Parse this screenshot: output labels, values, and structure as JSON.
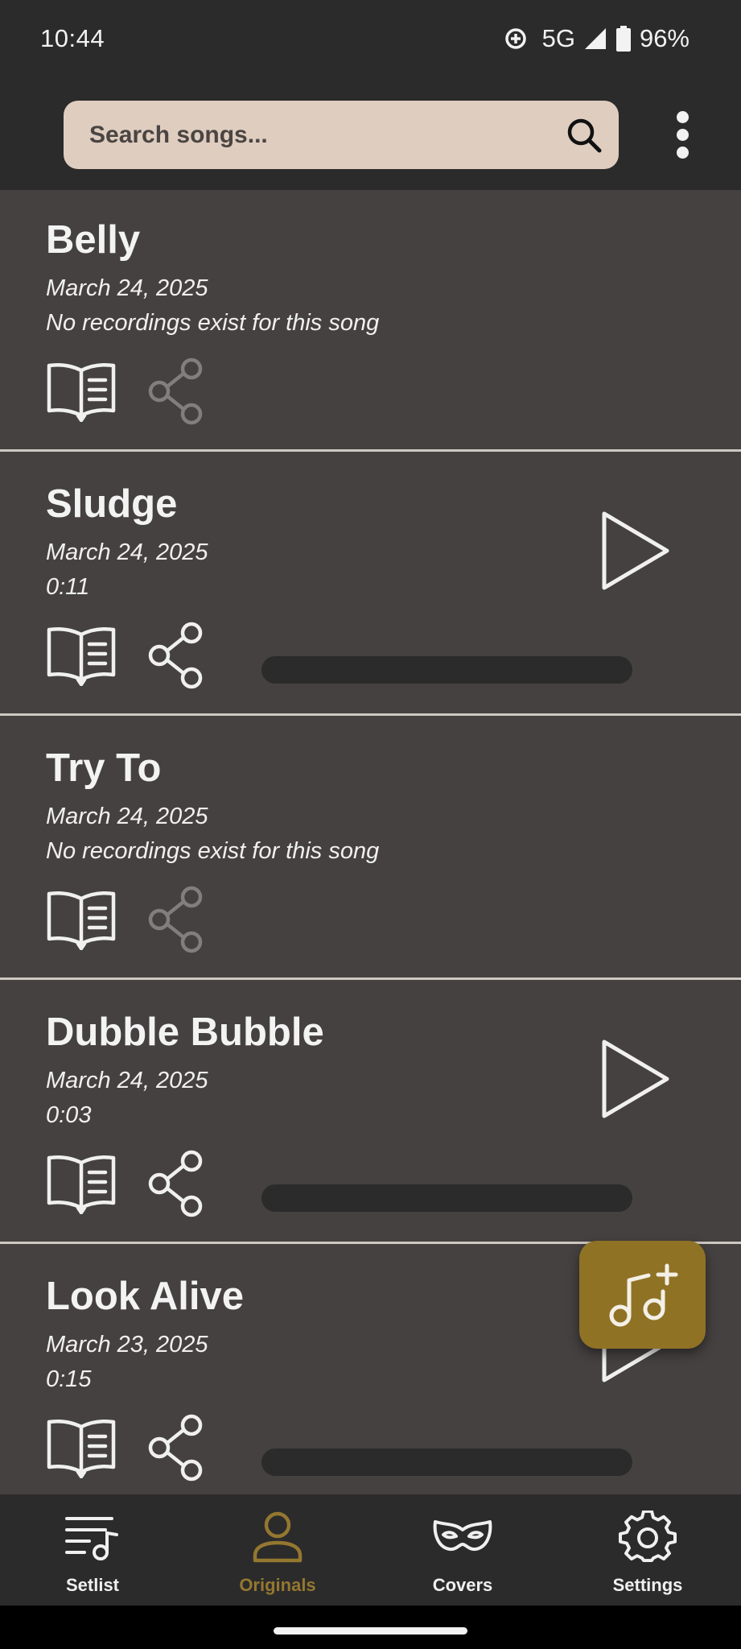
{
  "status_bar": {
    "time": "10:44",
    "network": "5G",
    "battery": "96%"
  },
  "search": {
    "placeholder": "Search songs...",
    "value": ""
  },
  "songs": [
    {
      "title": "Belly",
      "date": "March 24, 2025",
      "detail": "No recordings exist for this song",
      "has_recording": false
    },
    {
      "title": "Sludge",
      "date": "March 24, 2025",
      "detail": "0:11",
      "has_recording": true,
      "progress": 0
    },
    {
      "title": "Try To",
      "date": "March 24, 2025",
      "detail": "No recordings exist for this song",
      "has_recording": false
    },
    {
      "title": "Dubble Bubble",
      "date": "March 24, 2025",
      "detail": "0:03",
      "has_recording": true,
      "progress": 0
    },
    {
      "title": "Look Alive",
      "date": "March 23, 2025",
      "detail": "0:15",
      "has_recording": true,
      "progress": 0
    }
  ],
  "fab": {
    "icon": "add-music-icon"
  },
  "nav": {
    "items": [
      {
        "label": "Setlist",
        "icon": "setlist-icon",
        "active": false
      },
      {
        "label": "Originals",
        "icon": "person-icon",
        "active": true
      },
      {
        "label": "Covers",
        "icon": "mask-icon",
        "active": false
      },
      {
        "label": "Settings",
        "icon": "gear-icon",
        "active": false
      }
    ]
  },
  "colors": {
    "background": "#2b2b2b",
    "card": "#454140",
    "search": "#dfcdc0",
    "accent": "#907225",
    "active_nav": "#947730"
  }
}
